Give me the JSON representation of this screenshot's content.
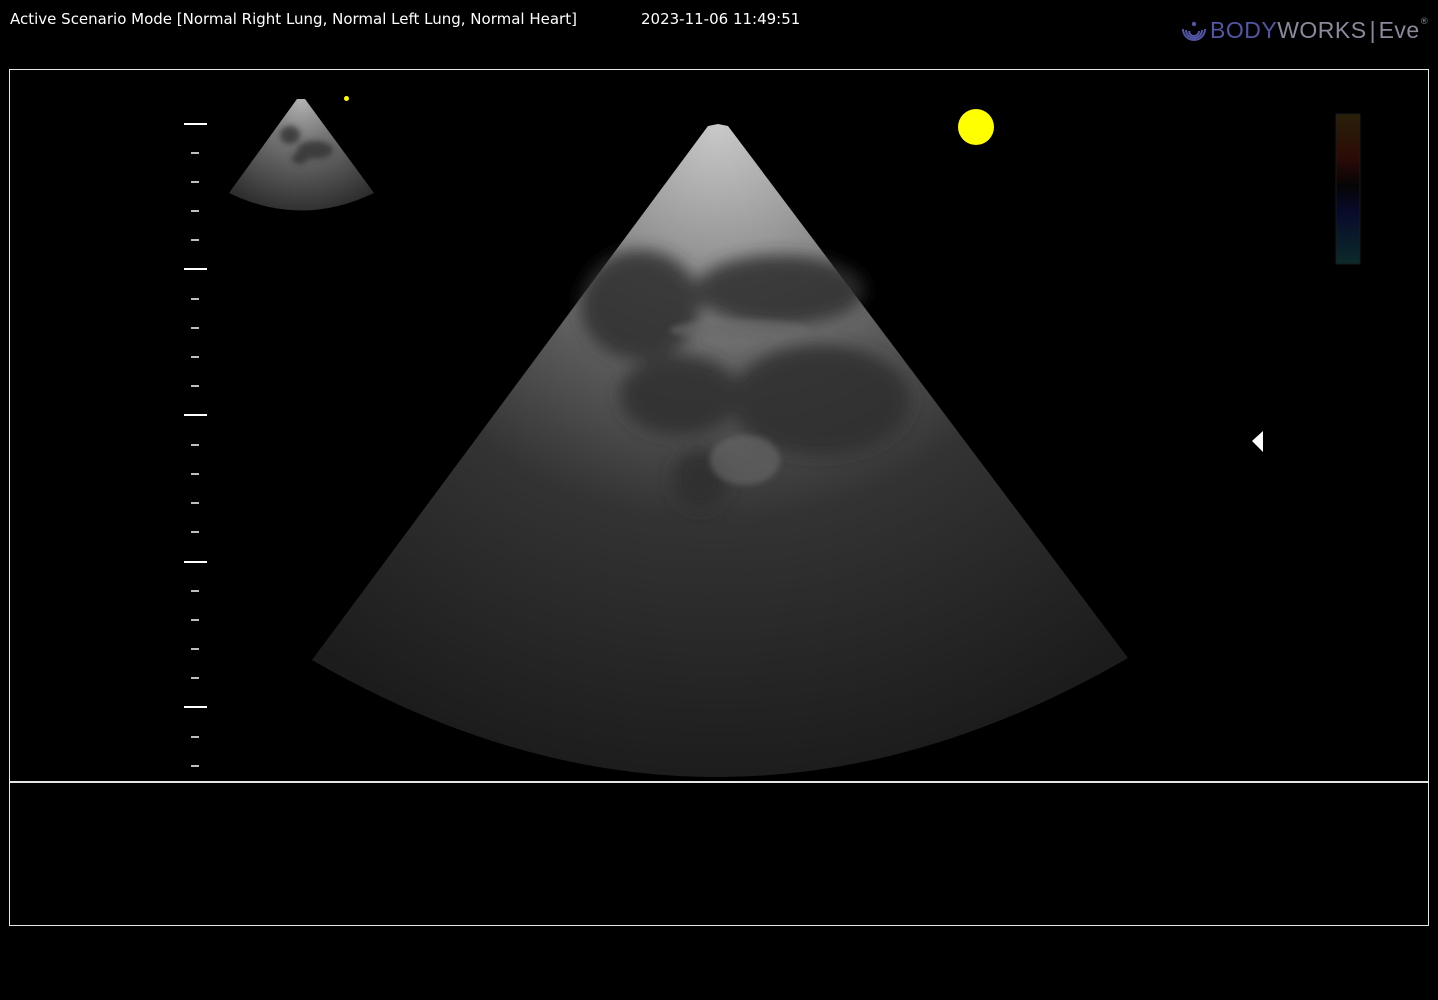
{
  "header": {
    "scenario_text": "Active Scenario Mode [Normal Right Lung, Normal Left Lung, Normal Heart]",
    "timestamp": "2023-11-06 11:49:51"
  },
  "logo": {
    "part1": "BODY",
    "part2": "WORKS",
    "separator": "|",
    "product": "Eve",
    "registered": "®",
    "icon": "ultrasound-waves-icon"
  },
  "colors": {
    "background": "#000000",
    "border": "#e6e6e6",
    "indicator": "#ffff00",
    "logo_primary": "#5355a6",
    "logo_secondary": "#8a8a9c"
  },
  "icons": {
    "focus_marker": "left-triangle-icon",
    "orientation_dot": "yellow-dot-icon",
    "thumbnail_dot": "small-yellow-dot-icon"
  }
}
